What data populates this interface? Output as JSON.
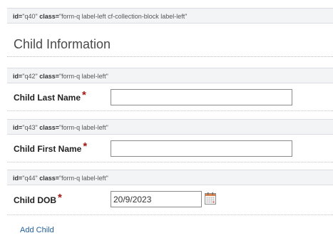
{
  "collection_block": {
    "debug": {
      "id_key": "id=",
      "id_value": "\"q40\"",
      "class_key": "class=",
      "class_value": "\"form-q label-left cf-collection-block label-left\""
    },
    "title": "Child Information"
  },
  "fields": [
    {
      "debug": {
        "id_key": "id=",
        "id_value": "\"q42\"",
        "class_key": "class=",
        "class_value": "\"form-q label-left\""
      },
      "label": "Child Last Name",
      "required_marker": "*",
      "value": ""
    },
    {
      "debug": {
        "id_key": "id=",
        "id_value": "\"q43\"",
        "class_key": "class=",
        "class_value": "\"form-q label-left\""
      },
      "label": "Child First Name",
      "required_marker": "*",
      "value": ""
    },
    {
      "debug": {
        "id_key": "id=",
        "id_value": "\"q44\"",
        "class_key": "class=",
        "class_value": "\"form-q label-left\""
      },
      "label": "Child DOB",
      "required_marker": "*",
      "value": "20/9/2023",
      "icon": "calendar-icon"
    }
  ],
  "add_child_label": "Add Child",
  "colors": {
    "required": "#a11919",
    "link": "#1f5f9e",
    "debug_bar_bg": "#f3f4f6"
  }
}
